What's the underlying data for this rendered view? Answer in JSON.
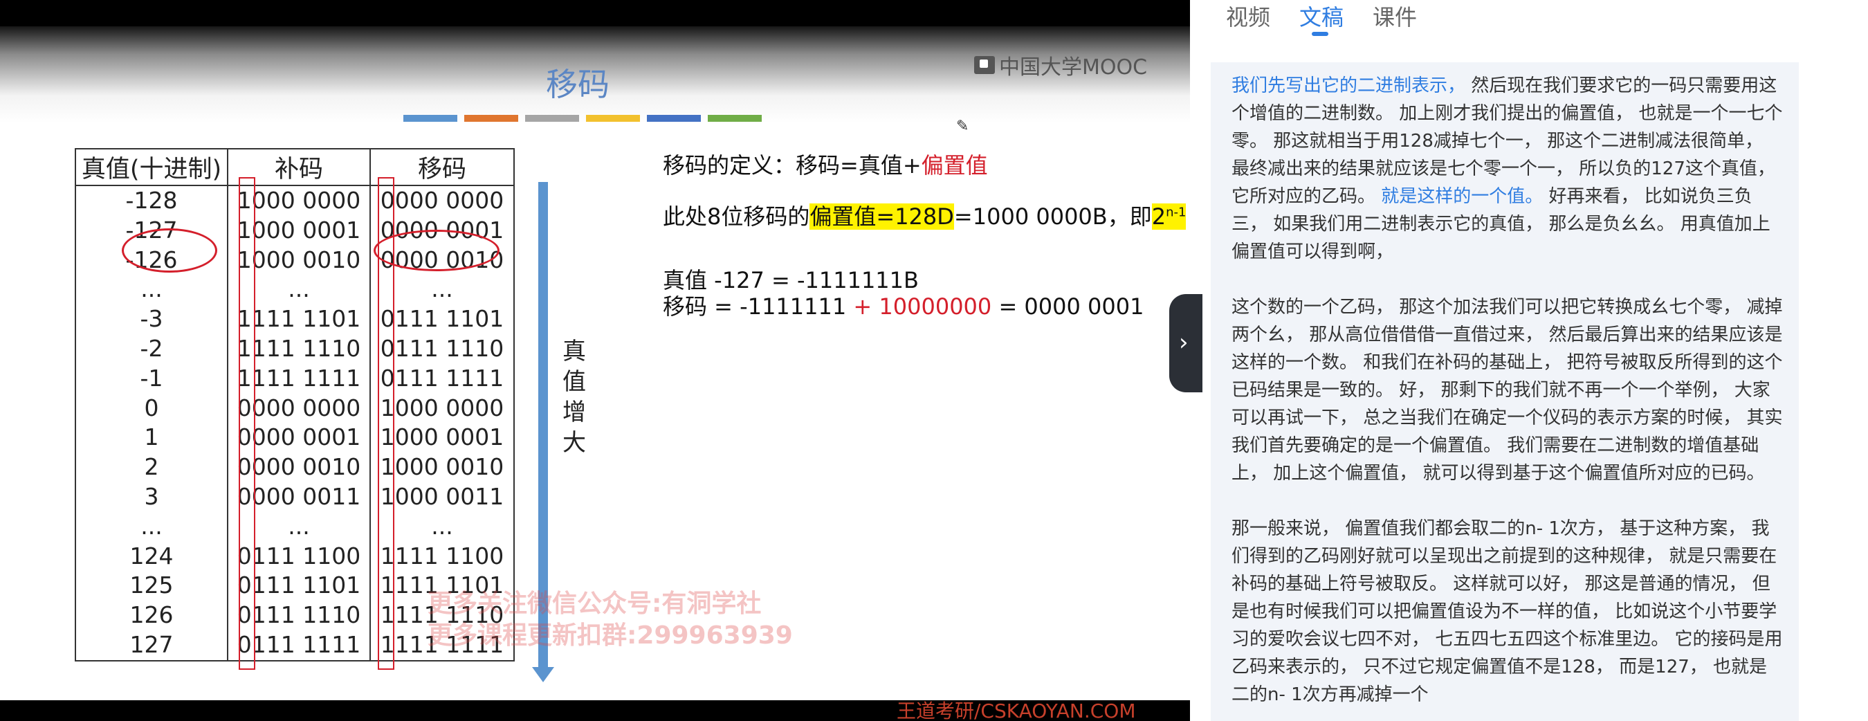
{
  "slide": {
    "title": "移码",
    "color_bars": [
      "#5b94cf",
      "#e0762f",
      "#a6a6a6",
      "#f2c12e",
      "#4472c4",
      "#70ad47"
    ],
    "logo": "中国大学MOOC",
    "table": {
      "headers": [
        "真值(十进制)",
        "补码",
        "移码"
      ],
      "rows": [
        [
          "-128",
          "1000 0000",
          "0000 0000"
        ],
        [
          "-127",
          "1000 0001",
          "0000 0001"
        ],
        [
          "-126",
          "1000 0010",
          "0000 0010"
        ],
        [
          "...",
          "...",
          "..."
        ],
        [
          "-3",
          "1111 1101",
          "0111 1101"
        ],
        [
          "-2",
          "1111 1110",
          "0111 1110"
        ],
        [
          "-1",
          "1111 1111",
          "0111 1111"
        ],
        [
          "0",
          "0000 0000",
          "1000 0000"
        ],
        [
          "1",
          "0000 0001",
          "1000 0001"
        ],
        [
          "2",
          "0000 0010",
          "1000 0010"
        ],
        [
          "3",
          "0000 0011",
          "1000 0011"
        ],
        [
          "...",
          "...",
          "..."
        ],
        [
          "124",
          "0111 1100",
          "1111 1100"
        ],
        [
          "125",
          "0111 1101",
          "1111 1101"
        ],
        [
          "126",
          "0111 1110",
          "1111 1110"
        ],
        [
          "127",
          "0111 1111",
          "1111 1111"
        ]
      ]
    },
    "arrow_label": "真值增大",
    "definition_prefix": "移码的定义：移码=真值+",
    "definition_highlight": "偏置值",
    "bias_prefix": "此处8位移码的",
    "bias_highlight": "偏置值=128D",
    "bias_mid": "=1000 0000B，即",
    "bias_power_base": "2",
    "bias_power_exp": "n-1",
    "example_true": "真值 -127 = -1111111B",
    "example_shift_prefix": "移码 = -1111111 ",
    "example_shift_red": "+ 10000000",
    "example_shift_suffix": " = 0000 0001",
    "watermark_line1": "更多关注微信公众号:有洞学社",
    "watermark_line2": "更多课程更新扣群:299963939",
    "footer_brand": "王道考研/CSKAOYAN.COM"
  },
  "tabs": [
    {
      "label": "视频",
      "active": false
    },
    {
      "label": "文稿",
      "active": true
    },
    {
      "label": "课件",
      "active": false
    }
  ],
  "transcript": {
    "p1_highlight": "我们先写出它的二进制表示，",
    "p1_text_a": " 然后现在我们要求它的一码只需要用这个增值的二进制数。 加上刚才我们提出的偏置值， 也就是一个一七个零。 那这就相当于用128减掉七个一， 那这个二进制减法很简单， 最终减出来的结果就应该是七个零一个一， 所以负的127这个真值， 它所对应的乙码。",
    "p1_highlight2": " 就是这样的一个值。",
    "p1_text_b": " 好再来看， 比如说负三负三， 如果我们用二进制表示它的真值， 那么是负幺幺。 用真值加上偏置值可以得到啊，",
    "p2": "这个数的一个乙码， 那这个加法我们可以把它转换成幺七个零， 减掉两个幺， 那从高位借借借一直借过来， 然后最后算出来的结果应该是这样的一个数。 和我们在补码的基础上， 把符号被取反所得到的这个已码结果是一致的。 好， 那剩下的我们就不再一个一个举例， 大家可以再试一下， 总之当我们在确定一个仪码的表示方案的时候， 其实我们首先要确定的是一个偏置值。 我们需要在二进制数的增值基础上， 加上这个偏置值， 就可以得到基于这个偏置值所对应的已码。",
    "p3": "那一般来说， 偏置值我们都会取二的n- 1次方， 基于这种方案， 我们得到的乙码刚好就可以呈现出之前提到的这种规律， 就是只需要在补码的基础上符号被取反。 这样就可以好， 那这是普通的情况， 但是也有时候我们可以把偏置值设为不一样的值， 比如说这个小节要学习的爱吹会议七四不对， 七五四七五四这个标准里边。 它的接码是用乙码来表示的， 只不过它规定偏置值不是128， 而是127， 也就是二的n- 1次方再减掉一个"
  }
}
